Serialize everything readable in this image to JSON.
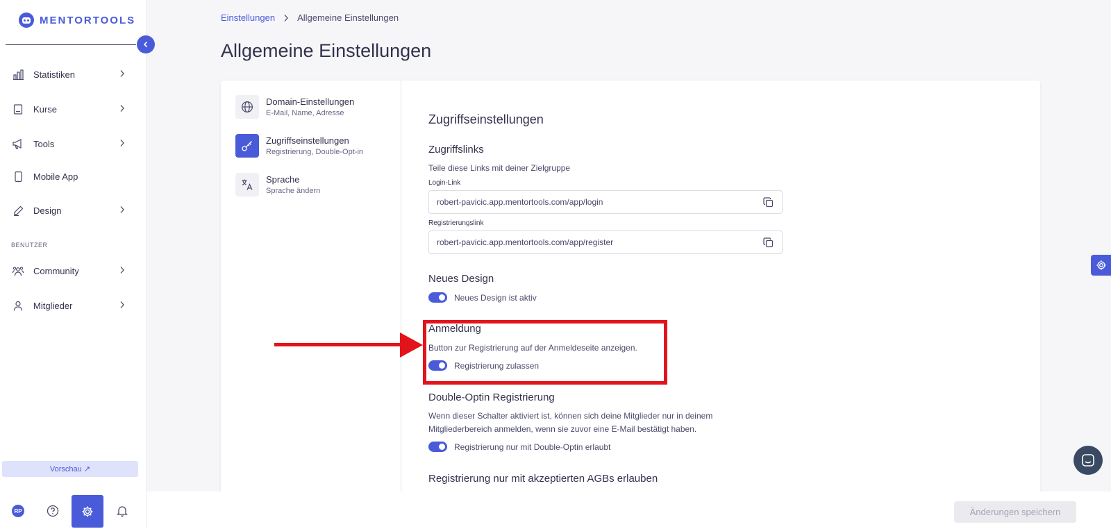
{
  "brand": {
    "name": "MENTORTOOLS"
  },
  "sidebar": {
    "items": [
      {
        "label": "Statistiken",
        "icon": "bar-chart-icon",
        "has_chevron": true
      },
      {
        "label": "Kurse",
        "icon": "book-icon",
        "has_chevron": true
      },
      {
        "label": "Tools",
        "icon": "megaphone-icon",
        "has_chevron": true
      },
      {
        "label": "Mobile App",
        "icon": "phone-icon",
        "has_chevron": false
      },
      {
        "label": "Design",
        "icon": "pencil-icon",
        "has_chevron": true
      }
    ],
    "section_label": "BENUTZER",
    "user_items": [
      {
        "label": "Community",
        "icon": "people-icon",
        "has_chevron": true
      },
      {
        "label": "Mitglieder",
        "icon": "person-icon",
        "has_chevron": true
      }
    ],
    "preview_label": "Vorschau ↗",
    "avatar_initials": "RP"
  },
  "breadcrumb": {
    "parent": "Einstellungen",
    "current": "Allgemeine Einstellungen"
  },
  "page_title": "Allgemeine Einstellungen",
  "settings_nav": [
    {
      "title": "Domain-Einstellungen",
      "subtitle": "E-Mail, Name, Adresse",
      "icon": "globe-icon",
      "active": false
    },
    {
      "title": "Zugriffseinstellungen",
      "subtitle": "Registrierung, Double-Opt-in",
      "icon": "key-icon",
      "active": true
    },
    {
      "title": "Sprache",
      "subtitle": "Sprache ändern",
      "icon": "translate-icon",
      "active": false
    }
  ],
  "content": {
    "section_title": "Zugriffseinstellungen",
    "access_links": {
      "title": "Zugriffslinks",
      "description": "Teile diese Links mit deiner Zielgruppe",
      "login_label": "Login-Link",
      "login_value": "robert-pavicic.app.mentortools.com/app/login",
      "register_label": "Registrierungslink",
      "register_value": "robert-pavicic.app.mentortools.com/app/register"
    },
    "new_design": {
      "title": "Neues Design",
      "toggle_label": "Neues Design ist aktiv",
      "enabled": true
    },
    "login": {
      "title": "Anmeldung",
      "description": "Button zur Registrierung auf der Anmeldeseite anzeigen.",
      "toggle_label": "Registrierung zulassen",
      "enabled": true
    },
    "double_optin": {
      "title": "Double-Optin Registrierung",
      "description_line1": "Wenn dieser Schalter aktiviert ist, können sich deine Mitglieder nur in deinem",
      "description_line2": "Mitgliederbereich anmelden, wenn sie zuvor eine E-Mail bestätigt haben.",
      "toggle_label": "Registrierung nur mit Double-Optin erlaubt",
      "enabled": true
    },
    "agb": {
      "title": "Registrierung nur mit akzeptierten AGBs erlauben"
    }
  },
  "footer": {
    "save_label": "Änderungen speichern"
  },
  "colors": {
    "accent": "#4a5bd9",
    "highlight": "#e3131b"
  }
}
